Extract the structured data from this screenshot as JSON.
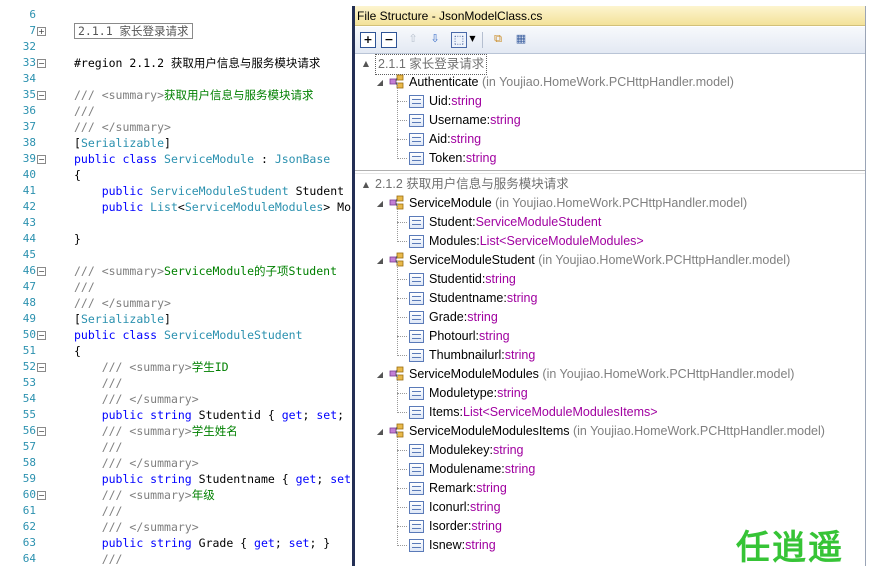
{
  "editor": {
    "lines": [
      {
        "n": "6",
        "fold": "",
        "html": ""
      },
      {
        "n": "7",
        "fold": "+",
        "region_box": "2.1.1 家长登录请求"
      },
      {
        "n": "32",
        "fold": "",
        "html": ""
      },
      {
        "n": "33",
        "fold": "−",
        "parts": [
          [
            "kw0",
            "#region 2.1.2 获取用户信息与服务模块请求"
          ]
        ]
      },
      {
        "n": "34",
        "fold": "",
        "html": ""
      },
      {
        "n": "35",
        "fold": "−",
        "parts": [
          [
            "gray",
            "/// <summary>"
          ],
          [
            "cm",
            "获取用户信息与服务模块请求"
          ]
        ]
      },
      {
        "n": "36",
        "fold": "",
        "parts": [
          [
            "gray",
            "///"
          ]
        ]
      },
      {
        "n": "37",
        "fold": "",
        "parts": [
          [
            "gray",
            "/// </summary>"
          ]
        ]
      },
      {
        "n": "38",
        "fold": "",
        "parts": [
          [
            "txt",
            "["
          ],
          [
            "type",
            "Serializable"
          ],
          [
            "txt",
            "]"
          ]
        ]
      },
      {
        "n": "39",
        "fold": "−",
        "parts": [
          [
            "kw",
            "public class "
          ],
          [
            "type",
            "ServiceModule"
          ],
          [
            "txt",
            " : "
          ],
          [
            "type",
            "JsonBase"
          ]
        ]
      },
      {
        "n": "40",
        "fold": "",
        "parts": [
          [
            "txt",
            "{"
          ]
        ]
      },
      {
        "n": "41",
        "fold": "",
        "parts": [
          [
            "txt",
            "    "
          ],
          [
            "kw",
            "public "
          ],
          [
            "type",
            "ServiceModuleStudent"
          ],
          [
            "txt",
            " Student"
          ]
        ]
      },
      {
        "n": "42",
        "fold": "",
        "parts": [
          [
            "txt",
            "    "
          ],
          [
            "kw",
            "public "
          ],
          [
            "type",
            "List"
          ],
          [
            "txt",
            "<"
          ],
          [
            "type",
            "ServiceModuleModules"
          ],
          [
            "txt",
            "> Mo"
          ]
        ]
      },
      {
        "n": "43",
        "fold": "",
        "html": ""
      },
      {
        "n": "44",
        "fold": "",
        "parts": [
          [
            "txt",
            "}"
          ]
        ]
      },
      {
        "n": "45",
        "fold": "",
        "html": ""
      },
      {
        "n": "46",
        "fold": "−",
        "parts": [
          [
            "gray",
            "/// <summary>"
          ],
          [
            "cm",
            "ServiceModule的子项Student"
          ]
        ]
      },
      {
        "n": "47",
        "fold": "",
        "parts": [
          [
            "gray",
            "///"
          ]
        ]
      },
      {
        "n": "48",
        "fold": "",
        "parts": [
          [
            "gray",
            "/// </summary>"
          ]
        ]
      },
      {
        "n": "49",
        "fold": "",
        "parts": [
          [
            "txt",
            "["
          ],
          [
            "type",
            "Serializable"
          ],
          [
            "txt",
            "]"
          ]
        ]
      },
      {
        "n": "50",
        "fold": "−",
        "parts": [
          [
            "kw",
            "public class "
          ],
          [
            "type",
            "ServiceModuleStudent"
          ]
        ]
      },
      {
        "n": "51",
        "fold": "",
        "parts": [
          [
            "txt",
            "{"
          ]
        ]
      },
      {
        "n": "52",
        "fold": "−",
        "parts": [
          [
            "txt",
            "    "
          ],
          [
            "gray",
            "/// <summary>"
          ],
          [
            "cm",
            "学生ID"
          ]
        ]
      },
      {
        "n": "53",
        "fold": "",
        "parts": [
          [
            "txt",
            "    "
          ],
          [
            "gray",
            "///"
          ]
        ]
      },
      {
        "n": "54",
        "fold": "",
        "parts": [
          [
            "txt",
            "    "
          ],
          [
            "gray",
            "/// </summary>"
          ]
        ]
      },
      {
        "n": "55",
        "fold": "",
        "parts": [
          [
            "txt",
            "    "
          ],
          [
            "kw",
            "public string "
          ],
          [
            "txt",
            "Studentid { "
          ],
          [
            "kw",
            "get"
          ],
          [
            "txt",
            "; "
          ],
          [
            "kw",
            "set"
          ],
          [
            "txt",
            ";"
          ]
        ]
      },
      {
        "n": "56",
        "fold": "−",
        "parts": [
          [
            "txt",
            "    "
          ],
          [
            "gray",
            "/// <summary>"
          ],
          [
            "cm",
            "学生姓名"
          ]
        ]
      },
      {
        "n": "57",
        "fold": "",
        "parts": [
          [
            "txt",
            "    "
          ],
          [
            "gray",
            "///"
          ]
        ]
      },
      {
        "n": "58",
        "fold": "",
        "parts": [
          [
            "txt",
            "    "
          ],
          [
            "gray",
            "/// </summary>"
          ]
        ]
      },
      {
        "n": "59",
        "fold": "",
        "parts": [
          [
            "txt",
            "    "
          ],
          [
            "kw",
            "public string "
          ],
          [
            "txt",
            "Studentname { "
          ],
          [
            "kw",
            "get"
          ],
          [
            "txt",
            "; "
          ],
          [
            "kw",
            "set"
          ]
        ]
      },
      {
        "n": "60",
        "fold": "−",
        "parts": [
          [
            "txt",
            "    "
          ],
          [
            "gray",
            "/// <summary>"
          ],
          [
            "cm",
            "年级"
          ]
        ]
      },
      {
        "n": "61",
        "fold": "",
        "parts": [
          [
            "txt",
            "    "
          ],
          [
            "gray",
            "///"
          ]
        ]
      },
      {
        "n": "62",
        "fold": "",
        "parts": [
          [
            "txt",
            "    "
          ],
          [
            "gray",
            "/// </summary>"
          ]
        ]
      },
      {
        "n": "63",
        "fold": "",
        "parts": [
          [
            "txt",
            "    "
          ],
          [
            "kw",
            "public string "
          ],
          [
            "txt",
            "Grade { "
          ],
          [
            "kw",
            "get"
          ],
          [
            "txt",
            "; "
          ],
          [
            "kw",
            "set"
          ],
          [
            "txt",
            "; }"
          ]
        ]
      },
      {
        "n": "64",
        "fold": "",
        "parts": [
          [
            "txt",
            "    "
          ],
          [
            "gray",
            "///"
          ]
        ]
      }
    ]
  },
  "file_structure": {
    "title": "File Structure - JsonModelClass.cs",
    "toolbar_icons": [
      "expand-all-icon",
      "collapse-all-icon",
      "move-up-icon",
      "move-down-icon",
      "filter-icon",
      "dropdown-arrow-icon",
      "sync-icon",
      "settings-icon"
    ],
    "region1": {
      "label": "2.1.1 家长登录请求"
    },
    "authenticate": {
      "name": "Authenticate",
      "ns": "(in Youjiao.HomeWork.PCHttpHandler.model)"
    },
    "auth_fields": [
      {
        "name": "Uid",
        "type": "string"
      },
      {
        "name": "Username",
        "type": "string"
      },
      {
        "name": "Aid",
        "type": "string"
      },
      {
        "name": "Token",
        "type": "string"
      }
    ],
    "region2": {
      "label": "2.1.2 获取用户信息与服务模块请求"
    },
    "classes": [
      {
        "name": "ServiceModule",
        "ns": "(in Youjiao.HomeWork.PCHttpHandler.model)",
        "fields": [
          {
            "name": "Student",
            "type": "ServiceModuleStudent"
          },
          {
            "name": "Modules",
            "type": "List<ServiceModuleModules>"
          }
        ]
      },
      {
        "name": "ServiceModuleStudent",
        "ns": "(in Youjiao.HomeWork.PCHttpHandler.model)",
        "fields": [
          {
            "name": "Studentid",
            "type": "string"
          },
          {
            "name": "Studentname",
            "type": "string"
          },
          {
            "name": "Grade",
            "type": "string"
          },
          {
            "name": "Photourl",
            "type": "string"
          },
          {
            "name": "Thumbnailurl",
            "type": "string"
          }
        ]
      },
      {
        "name": "ServiceModuleModules",
        "ns": "(in Youjiao.HomeWork.PCHttpHandler.model)",
        "fields": [
          {
            "name": "Moduletype",
            "type": "string"
          },
          {
            "name": "Items",
            "type": "List<ServiceModuleModulesItems>"
          }
        ]
      },
      {
        "name": "ServiceModuleModulesItems",
        "ns": "(in Youjiao.HomeWork.PCHttpHandler.model)",
        "fields": [
          {
            "name": "Modulekey",
            "type": "string"
          },
          {
            "name": "Modulename",
            "type": "string"
          },
          {
            "name": "Remark",
            "type": "string"
          },
          {
            "name": "Iconurl",
            "type": "string"
          },
          {
            "name": "Isorder",
            "type": "string"
          },
          {
            "name": "Isnew",
            "type": "string"
          }
        ]
      }
    ]
  },
  "watermark": {
    "text": "任逍遥"
  },
  "colors": {
    "keyword": "#0000ff",
    "comment": "#008000",
    "type": "#2b91af",
    "member_type": "#a000a0",
    "namespace": "#808080"
  }
}
